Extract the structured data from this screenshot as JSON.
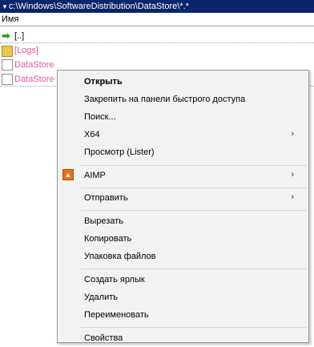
{
  "path": {
    "text": "c:\\Windows\\SoftwareDistribution\\DataStore\\*.*"
  },
  "column_header": {
    "name_label": "Имя"
  },
  "files": [
    {
      "label": "[..]",
      "icon": "up-arrow-icon"
    },
    {
      "label": "[Logs]",
      "icon": "folder-icon"
    },
    {
      "label": "DataStore",
      "icon": "file-icon"
    },
    {
      "label": "DataStore",
      "icon": "file-icon"
    }
  ],
  "menu": {
    "open": "Открыть",
    "pin_quick_access": "Закрепить на панели быстрого доступа",
    "search": "Поиск...",
    "x64": "X64",
    "lister": "Просмотр (Lister)",
    "aimp": "AIMP",
    "send_to": "Отправить",
    "cut": "Вырезать",
    "copy": "Копировать",
    "pack": "Упаковка файлов",
    "create_shortcut": "Создать ярлык",
    "delete": "Удалить",
    "rename": "Переименовать",
    "properties": "Свойства",
    "submenu_arrow": "›"
  },
  "colors": {
    "path_bar": "#0a246a",
    "pink_text": "#e05aa0",
    "menu_bg": "#f2f2f2",
    "aimp_icon": "#e8731c"
  }
}
